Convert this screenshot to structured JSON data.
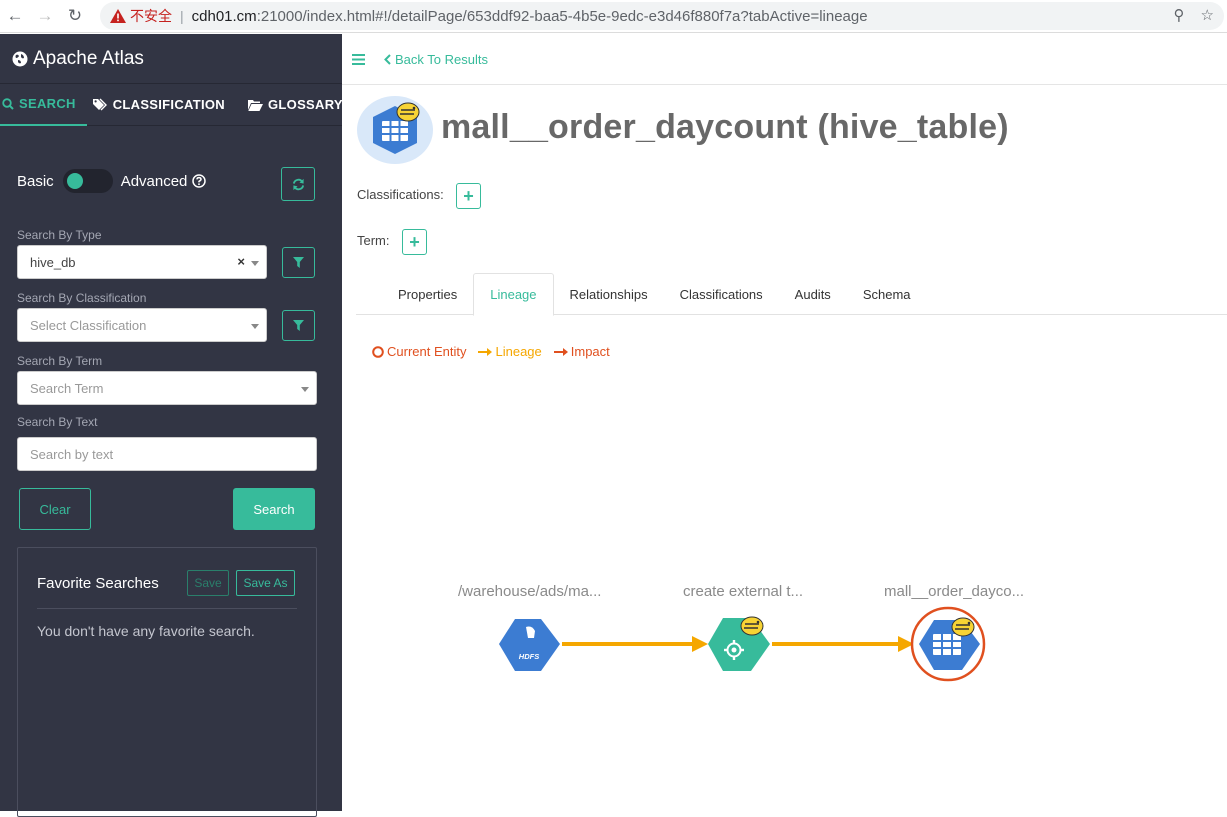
{
  "browser": {
    "insecure_label": "不安全",
    "separator": "|",
    "url_host": "cdh01.cm",
    "url_rest": ":21000/index.html#!/detailPage/653ddf92-baa5-4b5e-9edc-e3d46f880f7a?tabActive=lineage"
  },
  "sidebar": {
    "brand": "Apache Atlas",
    "tabs": [
      {
        "label": "SEARCH"
      },
      {
        "label": "CLASSIFICATION"
      },
      {
        "label": "GLOSSARY"
      }
    ],
    "toggle": {
      "left": "Basic",
      "right": "Advanced"
    },
    "search_by_type": {
      "label": "Search By Type",
      "value": "hive_db"
    },
    "search_by_classification": {
      "label": "Search By Classification",
      "placeholder": "Select Classification"
    },
    "search_by_term": {
      "label": "Search By Term",
      "placeholder": "Search Term"
    },
    "search_by_text": {
      "label": "Search By Text",
      "placeholder": "Search by text"
    },
    "clear_label": "Clear",
    "search_label": "Search",
    "favorites": {
      "title": "Favorite Searches",
      "save_label": "Save",
      "save_as_label": "Save As",
      "empty_text": "You don't have any favorite search."
    }
  },
  "main": {
    "back_label": "Back To Results",
    "entity_title": "mall__order_daycount (hive_table)",
    "classifications_label": "Classifications:",
    "term_label": "Term:",
    "tabs": [
      {
        "label": "Properties"
      },
      {
        "label": "Lineage"
      },
      {
        "label": "Relationships"
      },
      {
        "label": "Classifications"
      },
      {
        "label": "Audits"
      },
      {
        "label": "Schema"
      }
    ],
    "legend": {
      "current": "Current Entity",
      "lineage": "Lineage",
      "impact": "Impact"
    },
    "lineage_nodes": [
      {
        "label": "/warehouse/ads/ma...",
        "icon": "hdfs"
      },
      {
        "label": "create external t...",
        "icon": "hive-process"
      },
      {
        "label": "mall__order_dayco...",
        "icon": "hive-table"
      }
    ],
    "hdfs_text": "HDFS"
  },
  "colors": {
    "accent": "#37bb9b",
    "sidebar_bg": "#323544",
    "lineage": "#f5a700",
    "impact": "#e0501f"
  }
}
